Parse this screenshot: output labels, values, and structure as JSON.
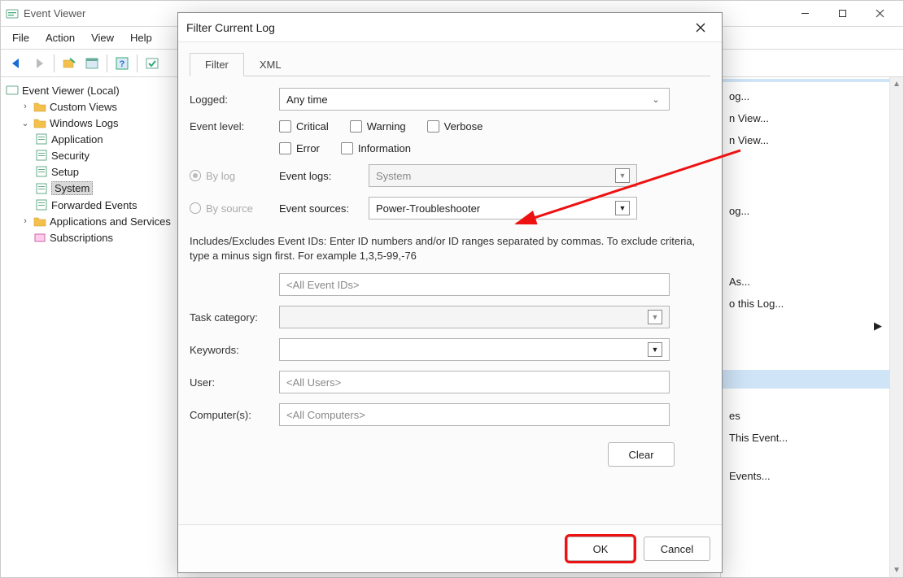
{
  "window": {
    "title": "Event Viewer"
  },
  "menubar": {
    "file": "File",
    "action": "Action",
    "view": "View",
    "help": "Help"
  },
  "tree": {
    "root": "Event Viewer (Local)",
    "custom_views": "Custom Views",
    "windows_logs": "Windows Logs",
    "application": "Application",
    "security": "Security",
    "setup": "Setup",
    "system": "System",
    "forwarded": "Forwarded Events",
    "apps_services": "Applications and Services",
    "subscriptions": "Subscriptions"
  },
  "actions": {
    "items": {
      "a0": "og...",
      "a1": "n View...",
      "a2": "n View...",
      "a3": "og...",
      "a4": " As...",
      "a5": "o this Log...",
      "a6": "es",
      "a7": " This Event...",
      "a8": " Events..."
    }
  },
  "dialog": {
    "title": "Filter Current Log",
    "tabs": {
      "filter": "Filter",
      "xml": "XML"
    },
    "labels": {
      "logged": "Logged:",
      "event_level": "Event level:",
      "by_log": "By log",
      "by_source": "By source",
      "event_logs": "Event logs:",
      "event_sources": "Event sources:",
      "task_category": "Task category:",
      "keywords": "Keywords:",
      "user": "User:",
      "computers": "Computer(s):"
    },
    "values": {
      "logged": "Any time",
      "event_logs": "System",
      "event_sources": "Power-Troubleshooter",
      "event_ids": "<All Event IDs>",
      "user": "<All Users>",
      "computers": "<All Computers>"
    },
    "checkboxes": {
      "critical": "Critical",
      "warning": "Warning",
      "verbose": "Verbose",
      "error": "Error",
      "information": "Information"
    },
    "desc": "Includes/Excludes Event IDs: Enter ID numbers and/or ID ranges separated by commas. To exclude criteria, type a minus sign first. For example 1,3,5-99,-76",
    "buttons": {
      "clear": "Clear",
      "ok": "OK",
      "cancel": "Cancel"
    }
  }
}
